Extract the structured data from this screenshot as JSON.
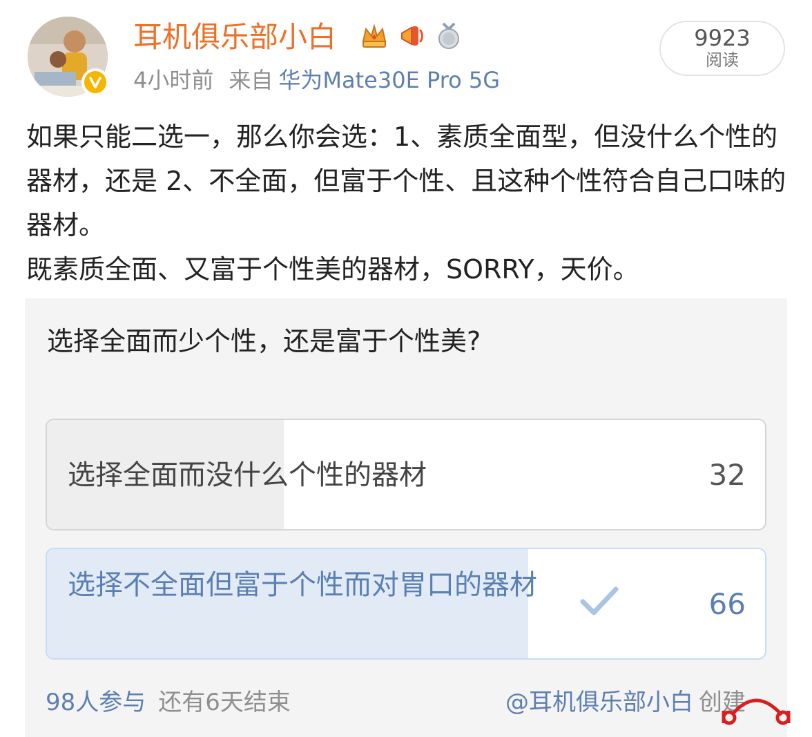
{
  "user": {
    "name": "耳机俱乐部小白",
    "post_time": "4小时前",
    "source_label": "来自",
    "source_device": "华为Mate30E Pro 5G",
    "medals": [
      "crown-medal-icon",
      "megaphone-medal-icon",
      "silver-answer-medal-icon"
    ]
  },
  "reads": {
    "count": "9923",
    "label": "阅读"
  },
  "post": {
    "paragraphs": [
      "如果只能二选一，那么你会选：1、素质全面型，但没什么个性的器材，还是 2、不全面，但富于个性、且这种个性符合自己口味的器材。",
      "既素质全面、又富于个性美的器材，SORRY，天价。"
    ]
  },
  "poll": {
    "question": "选择全面而少个性，还是富于个性美?",
    "options": [
      {
        "label": "选择全面而没什么个性的器材",
        "count": "32",
        "selected": false,
        "fraction": 0.33
      },
      {
        "label": "选择不全面但富于个性而对胃口的器材",
        "count": "66",
        "selected": true,
        "fraction": 0.67
      }
    ],
    "participants": "98人参与",
    "time_left": "还有6天结束",
    "creator_name": "@耳机俱乐部小白",
    "creator_suffix": "创建"
  },
  "colors": {
    "username": "#ef6f26",
    "link": "#5d7fb0",
    "selected_text": "#5a7fb3",
    "selected_fill": "#e2ebf5",
    "verified": "#f6b600"
  }
}
